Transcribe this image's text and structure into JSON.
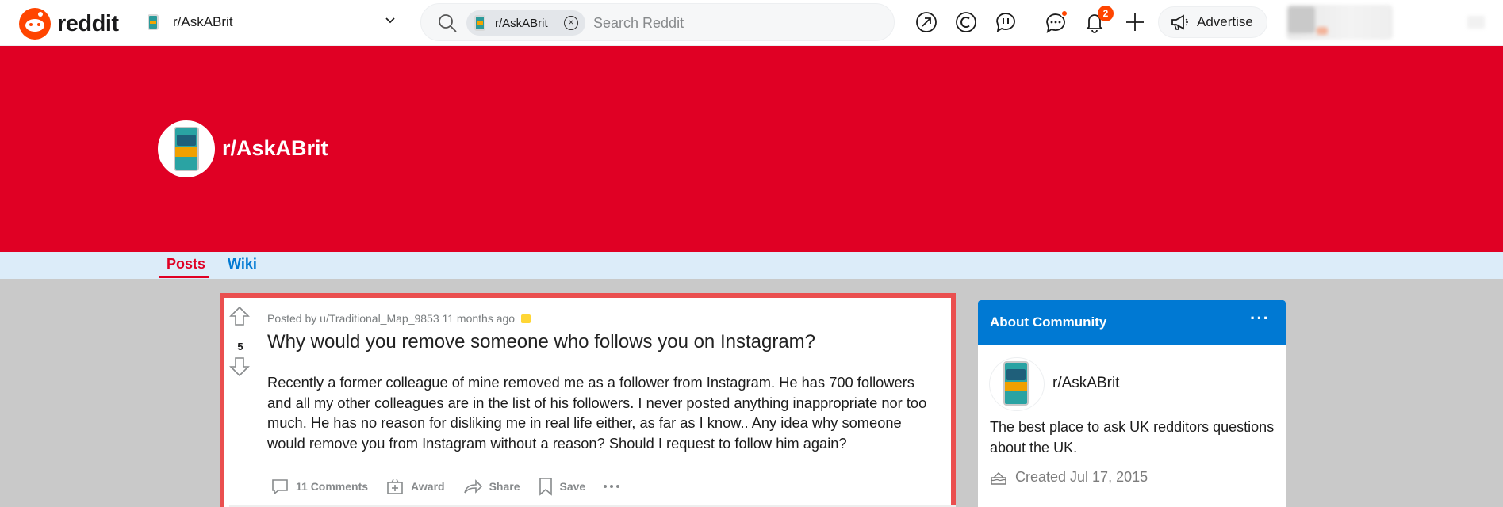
{
  "header": {
    "logo_text": "reddit",
    "community": "r/AskABrit",
    "search": {
      "chip_label": "r/AskABrit",
      "placeholder": "Search Reddit"
    },
    "notification_count": "2",
    "advertise_label": "Advertise"
  },
  "banner": {
    "community_title": "r/AskABrit"
  },
  "tabs": [
    {
      "label": "Posts"
    },
    {
      "label": "Wiki"
    }
  ],
  "post": {
    "meta": "Posted by u/Traditional_Map_9853 11 months ago",
    "score": "5",
    "title": "Why would you remove someone who follows you on Instagram?",
    "body": "Recently a former colleague of mine removed me as a follower from Instagram. He has 700 followers and all my other colleagues are in the list of his followers. I never posted anything inappropriate nor too much. He has no reason for disliking me in real life either, as far as I know.. Any idea why someone would remove you from Instagram without a reason? Should I request to follow him again?",
    "actions": {
      "comments": "11 Comments",
      "award": "Award",
      "share": "Share",
      "save": "Save"
    }
  },
  "sidebar": {
    "title": "About Community",
    "community_name": "r/AskABrit",
    "description": "The best place to ask UK redditors questions about the UK.",
    "created": "Created Jul 17, 2015"
  },
  "colors": {
    "banner": "#e00024",
    "accent_blue": "#0079d3",
    "reddit_orange": "#ff4500",
    "highlight_border": "#ea4f4f"
  }
}
